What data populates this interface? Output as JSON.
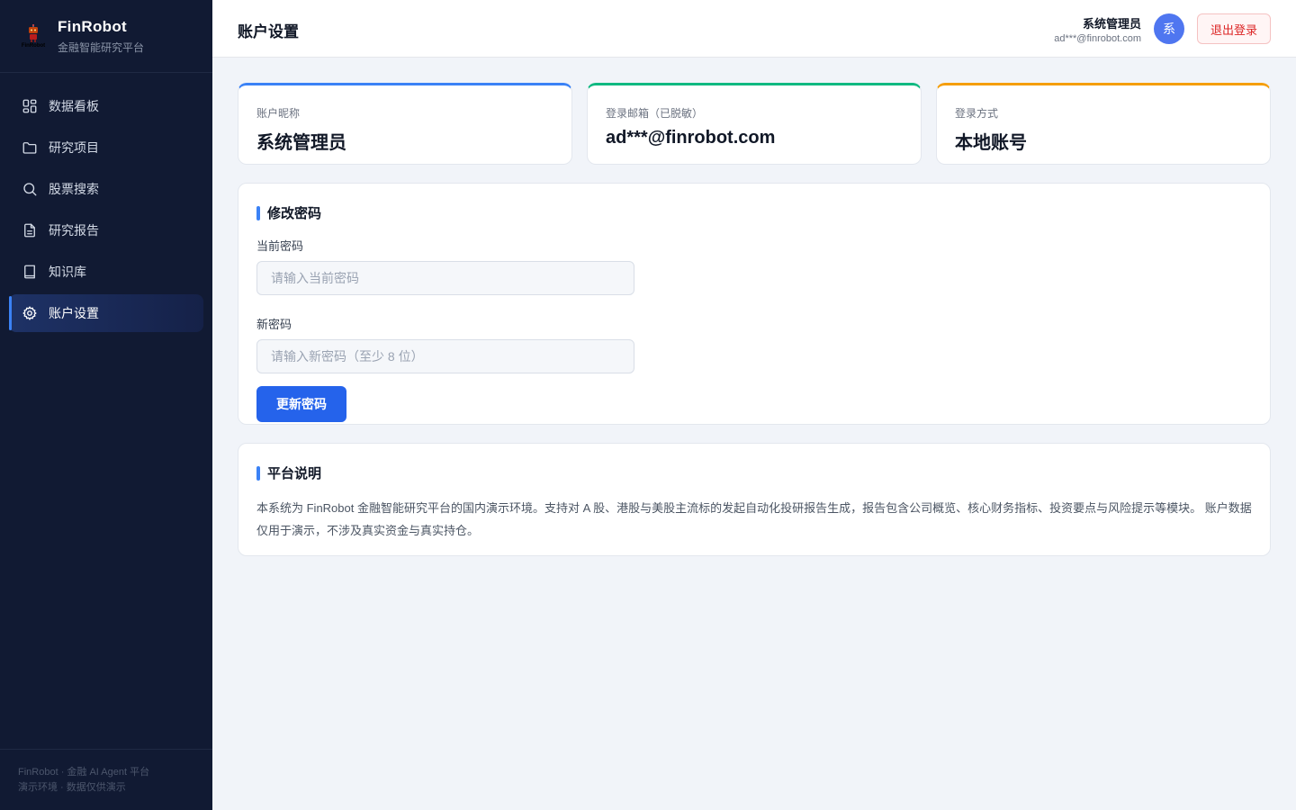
{
  "brand": {
    "title": "FinRobot",
    "subtitle": "金融智能研究平台",
    "logo_text": "FinRobot"
  },
  "nav": [
    {
      "label": "数据看板",
      "icon": "dashboard-icon",
      "active": false
    },
    {
      "label": "研究项目",
      "icon": "folder-icon",
      "active": false
    },
    {
      "label": "股票搜索",
      "icon": "search-icon",
      "active": false
    },
    {
      "label": "研究报告",
      "icon": "document-icon",
      "active": false
    },
    {
      "label": "知识库",
      "icon": "book-icon",
      "active": false
    },
    {
      "label": "账户设置",
      "icon": "gear-icon",
      "active": true
    }
  ],
  "sidebar_footer": {
    "line1": "FinRobot · 金融 AI Agent 平台",
    "line2": "演示环境 · 数据仅供演示"
  },
  "header": {
    "title": "账户设置",
    "user_name": "系统管理员",
    "user_email": "ad***@finrobot.com",
    "avatar_text": "系",
    "logout_label": "退出登录"
  },
  "info_cards": [
    {
      "label": "账户昵称",
      "value": "系统管理员",
      "accent": "#3b82f6"
    },
    {
      "label": "登录邮箱（已脱敏）",
      "value": "ad***@finrobot.com",
      "accent": "#10b981"
    },
    {
      "label": "登录方式",
      "value": "本地账号",
      "accent": "#f59e0b"
    }
  ],
  "password": {
    "title": "修改密码",
    "current_label": "当前密码",
    "current_placeholder": "请输入当前密码",
    "current_value": "",
    "new_label": "新密码",
    "new_placeholder": "请输入新密码（至少 8 位）",
    "new_value": "",
    "submit_label": "更新密码"
  },
  "about": {
    "title": "平台说明",
    "text": "本系统为 FinRobot 金融智能研究平台的国内演示环境。支持对 A 股、港股与美股主流标的发起自动化投研报告生成，报告包含公司概览、核心财务指标、投资要点与风险提示等模块。 账户数据仅用于演示，不涉及真实资金与真实持仓。"
  },
  "colors": {
    "sidebar_bg": "#111a33",
    "primary": "#2563eb",
    "danger": "#dc2626",
    "page_bg": "#f1f4f9"
  }
}
